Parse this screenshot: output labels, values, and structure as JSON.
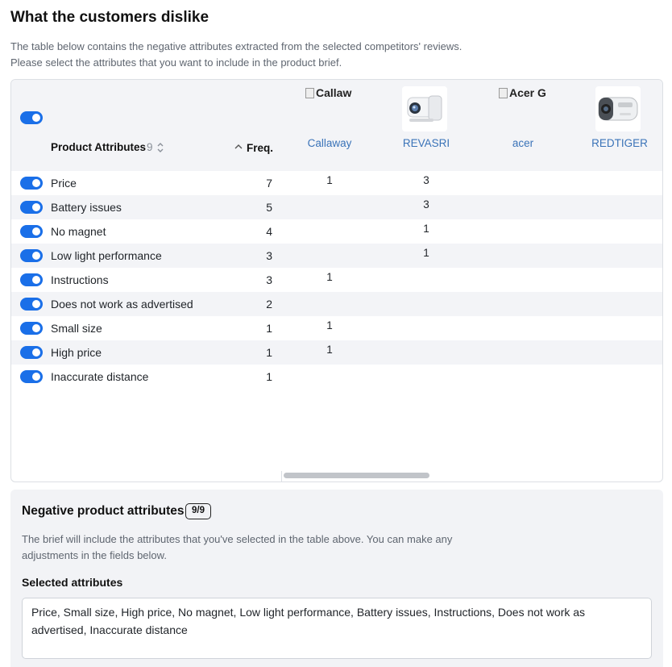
{
  "page": {
    "title": "What the customers dislike",
    "description_line1": "The table below contains the negative attributes extracted from the selected competitors' reviews.",
    "description_line2": "Please select the attributes that you want to include in the product brief."
  },
  "table": {
    "attribute_header": "Product Attributes",
    "attribute_count": "9",
    "freq_header": "Freq.",
    "competitors": [
      {
        "name": "Callaway",
        "image_alt": "Callaw",
        "image": "broken"
      },
      {
        "name": "REVASRI",
        "image": "rangefinder-white"
      },
      {
        "name": "acer",
        "image_alt": "Acer G",
        "image": "broken"
      },
      {
        "name": "REDTIGER",
        "image": "rangefinder-grey"
      }
    ],
    "rows": [
      {
        "label": "Price",
        "freq": "7",
        "cells": [
          "1",
          "3",
          "",
          ""
        ]
      },
      {
        "label": "Battery issues",
        "freq": "5",
        "cells": [
          "",
          "3",
          "",
          ""
        ]
      },
      {
        "label": "No magnet",
        "freq": "4",
        "cells": [
          "",
          "1",
          "",
          ""
        ]
      },
      {
        "label": "Low light performance",
        "freq": "3",
        "cells": [
          "",
          "1",
          "",
          ""
        ]
      },
      {
        "label": "Instructions",
        "freq": "3",
        "cells": [
          "1",
          "",
          "",
          ""
        ]
      },
      {
        "label": "Does not work as advertised",
        "freq": "2",
        "cells": [
          "",
          "",
          "",
          ""
        ]
      },
      {
        "label": "Small size",
        "freq": "1",
        "cells": [
          "1",
          "",
          "",
          ""
        ]
      },
      {
        "label": "High price",
        "freq": "1",
        "cells": [
          "1",
          "",
          "",
          ""
        ]
      },
      {
        "label": "Inaccurate distance",
        "freq": "1",
        "cells": [
          "",
          "",
          "",
          ""
        ]
      }
    ]
  },
  "brief": {
    "title": "Negative product attributes",
    "badge": "9/9",
    "description": "The brief will include the attributes that you've selected in the table above. You can make any adjustments in the fields below.",
    "selected_label": "Selected attributes",
    "selected_value": "Price, Small size, High price, No magnet, Low light performance, Battery issues, Instructions, Does not work as advertised, Inaccurate distance"
  },
  "colors": {
    "accent": "#1a6fe8",
    "link": "#3a73b8",
    "header_bg": "#f3f4f7"
  }
}
